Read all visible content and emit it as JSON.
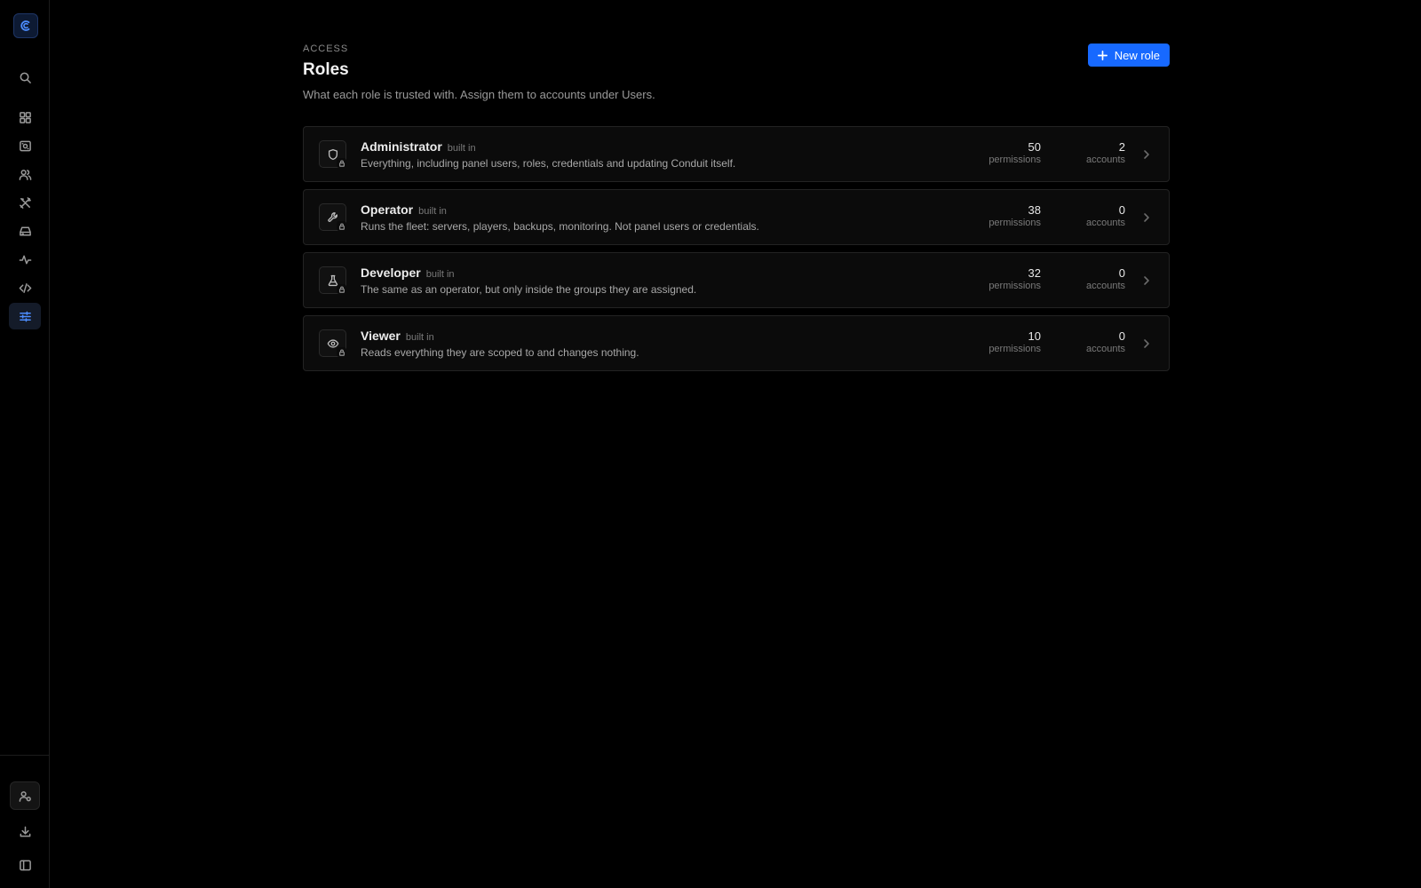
{
  "header": {
    "eyebrow": "ACCESS",
    "title": "Roles",
    "subtitle": "What each role is trusted with. Assign them to accounts under Users.",
    "new_button_label": "New role"
  },
  "sidebar": {
    "items": [
      {
        "icon": "search-icon"
      },
      {
        "icon": "dashboard-icon"
      },
      {
        "icon": "server-icon"
      },
      {
        "icon": "users-icon"
      },
      {
        "icon": "tools-icon"
      },
      {
        "icon": "storage-icon"
      },
      {
        "icon": "activity-icon"
      },
      {
        "icon": "code-icon"
      },
      {
        "icon": "sliders-icon",
        "active": true
      }
    ],
    "bottom": [
      {
        "icon": "user-settings-icon"
      },
      {
        "icon": "download-icon"
      },
      {
        "icon": "sidebar-toggle-icon"
      }
    ]
  },
  "roles": [
    {
      "name": "Administrator",
      "tag": "built in",
      "description": "Everything, including panel users, roles, credentials and updating Conduit itself.",
      "permissions": "50",
      "permissions_label": "permissions",
      "accounts": "2",
      "accounts_label": "accounts",
      "icon": "shield-icon"
    },
    {
      "name": "Operator",
      "tag": "built in",
      "description": "Runs the fleet: servers, players, backups, monitoring. Not panel users or credentials.",
      "permissions": "38",
      "permissions_label": "permissions",
      "accounts": "0",
      "accounts_label": "accounts",
      "icon": "wrench-icon"
    },
    {
      "name": "Developer",
      "tag": "built in",
      "description": "The same as an operator, but only inside the groups they are assigned.",
      "permissions": "32",
      "permissions_label": "permissions",
      "accounts": "0",
      "accounts_label": "accounts",
      "icon": "flask-icon"
    },
    {
      "name": "Viewer",
      "tag": "built in",
      "description": "Reads everything they are scoped to and changes nothing.",
      "permissions": "10",
      "permissions_label": "permissions",
      "accounts": "0",
      "accounts_label": "accounts",
      "icon": "eye-icon"
    }
  ],
  "colors": {
    "accent": "#1769ff",
    "active_icon": "#4d8dff",
    "background": "#000000"
  }
}
